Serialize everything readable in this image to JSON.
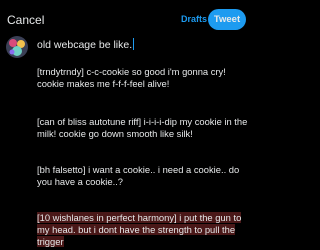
{
  "header": {
    "cancel_label": "Cancel",
    "drafts_label": "Drafts",
    "tweet_label": "Tweet"
  },
  "compose": {
    "first_line": "old webcage be like.",
    "paragraphs": [
      "[trndytrndy] c-c-cookie so good i'm gonna cry! cookie makes me f-f-f-feel alive!",
      "[can of bliss autotune riff] i-i-i-i-dip my cookie in the milk! cookie go down smooth like silk!",
      "[bh falsetto] i want a cookie.. i need a cookie.. do you have a cookie..?"
    ],
    "highlighted_paragraph": "[10 wishlanes in perfect harmony] i put the gun to my head. but i dont have the strength to pull the trigger"
  },
  "colors": {
    "accent": "#1d9bf0",
    "background": "#000000",
    "text": "#e7e9ea",
    "overflow_highlight": "#4a1818"
  },
  "icons": {
    "avatar": "profile-avatar"
  }
}
